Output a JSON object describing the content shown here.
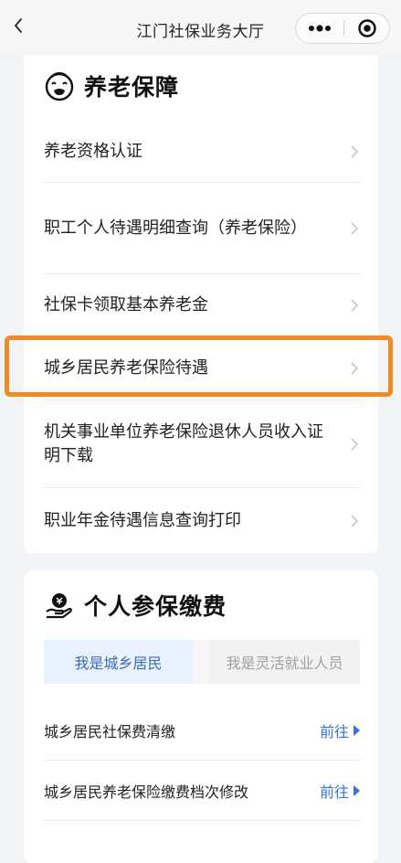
{
  "nav": {
    "title": "江门社保业务大厅"
  },
  "pension": {
    "title": "养老保障",
    "items": [
      {
        "label": "养老资格认证"
      },
      {
        "label": "职工个人待遇明细查询（养老保险）"
      },
      {
        "label": "社保卡领取基本养老金"
      },
      {
        "label": "城乡居民养老保险待遇"
      },
      {
        "label": "机关事业单位养老保险退休人员收入证明下载"
      },
      {
        "label": "职业年金待遇信息查询打印"
      }
    ],
    "highlight_color": "#f08a24"
  },
  "payment": {
    "title": "个人参保缴费",
    "tabs": [
      {
        "label": "我是城乡居民",
        "active": true
      },
      {
        "label": "我是灵活就业人员",
        "active": false
      }
    ],
    "rows": [
      {
        "label": "城乡居民社保费清缴",
        "action": "前往"
      },
      {
        "label": "城乡居民养老保险缴费档次修改",
        "action": "前往"
      }
    ]
  },
  "colors": {
    "accent": "#3474d6",
    "tab_active_bg": "#e8f1fd"
  },
  "icons": {
    "back": "chevron-left-icon",
    "more": "more-dots-icon",
    "close": "capsule-close-icon",
    "pension": "elder-face-icon",
    "payment": "hand-coin-icon",
    "chevron": "chevron-right-icon",
    "go_arrow": "triangle-right-icon"
  }
}
